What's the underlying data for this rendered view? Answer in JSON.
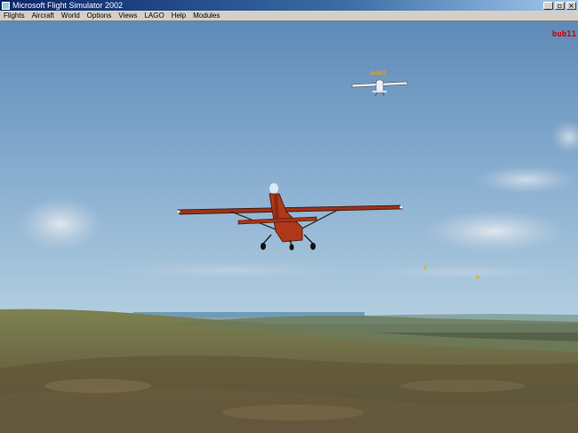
{
  "window": {
    "title": "Microsoft Flight Simulator 2002"
  },
  "menu": {
    "items": [
      "Flights",
      "Aircraft",
      "World",
      "Options",
      "Views",
      "LAGO",
      "Help",
      "Modules"
    ]
  },
  "scene": {
    "player_callsign": "bub11",
    "other_aircraft_label": "bub11"
  },
  "colors": {
    "sky_top": "#5e8ab8",
    "sky_horizon": "#b4cfe0",
    "player_plane": "#b0381a",
    "callsign_text": "#d00000"
  },
  "icons": [
    "app-icon",
    "minimize-icon",
    "restore-icon",
    "close-icon"
  ]
}
